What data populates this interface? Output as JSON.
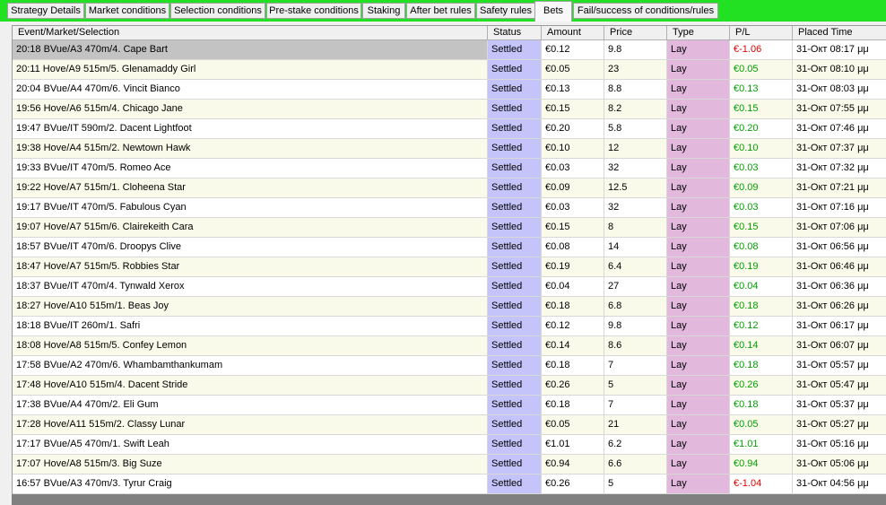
{
  "tabs": [
    {
      "label": "Strategy Details"
    },
    {
      "label": "Market conditions"
    },
    {
      "label": "Selection conditions"
    },
    {
      "label": "Pre-stake conditions"
    },
    {
      "label": "Staking"
    },
    {
      "label": "After bet rules"
    },
    {
      "label": "Safety rules"
    },
    {
      "label": "Bets",
      "active": true
    },
    {
      "label": "Fail/success of conditions/rules"
    }
  ],
  "colors": {
    "tab_strip": "#22e022",
    "status_column": "#c4c4fa",
    "type_column": "#e2b8dc",
    "profit": "#00a000",
    "loss": "#e00000",
    "selected_row": "#c3c3c3"
  },
  "columns": {
    "event": "Event/Market/Selection",
    "status": "Status",
    "amount": "Amount",
    "price": "Price",
    "type": "Type",
    "pl": "P/L",
    "time": "Placed Time"
  },
  "bets": [
    {
      "event": "20:18 BVue/A3 470m/4. Cape Bart",
      "status": "Settled",
      "amount": "€0.12",
      "price": "9.8",
      "type": "Lay",
      "pl": "€-1.06",
      "time": "31-Окт 08:17 μμ"
    },
    {
      "event": "20:11 Hove/A9 515m/5. Glenamaddy Girl",
      "status": "Settled",
      "amount": "€0.05",
      "price": "23",
      "type": "Lay",
      "pl": "€0.05",
      "time": "31-Окт 08:10 μμ"
    },
    {
      "event": "20:04 BVue/A4 470m/6. Vincit Bianco",
      "status": "Settled",
      "amount": "€0.13",
      "price": "8.8",
      "type": "Lay",
      "pl": "€0.13",
      "time": "31-Окт 08:03 μμ"
    },
    {
      "event": "19:56 Hove/A6 515m/4. Chicago Jane",
      "status": "Settled",
      "amount": "€0.15",
      "price": "8.2",
      "type": "Lay",
      "pl": "€0.15",
      "time": "31-Окт 07:55 μμ"
    },
    {
      "event": "19:47 BVue/IT 590m/2. Dacent Lightfoot",
      "status": "Settled",
      "amount": "€0.20",
      "price": "5.8",
      "type": "Lay",
      "pl": "€0.20",
      "time": "31-Окт 07:46 μμ"
    },
    {
      "event": "19:38 Hove/A4 515m/2. Newtown Hawk",
      "status": "Settled",
      "amount": "€0.10",
      "price": "12",
      "type": "Lay",
      "pl": "€0.10",
      "time": "31-Окт 07:37 μμ"
    },
    {
      "event": "19:33 BVue/IT 470m/5. Romeo Ace",
      "status": "Settled",
      "amount": "€0.03",
      "price": "32",
      "type": "Lay",
      "pl": "€0.03",
      "time": "31-Окт 07:32 μμ"
    },
    {
      "event": "19:22 Hove/A7 515m/1. Cloheena Star",
      "status": "Settled",
      "amount": "€0.09",
      "price": "12.5",
      "type": "Lay",
      "pl": "€0.09",
      "time": "31-Окт 07:21 μμ"
    },
    {
      "event": "19:17 BVue/IT 470m/5. Fabulous Cyan",
      "status": "Settled",
      "amount": "€0.03",
      "price": "32",
      "type": "Lay",
      "pl": "€0.03",
      "time": "31-Окт 07:16 μμ"
    },
    {
      "event": "19:07 Hove/A7 515m/6. Clairekeith Cara",
      "status": "Settled",
      "amount": "€0.15",
      "price": "8",
      "type": "Lay",
      "pl": "€0.15",
      "time": "31-Окт 07:06 μμ"
    },
    {
      "event": "18:57 BVue/IT 470m/6. Droopys Clive",
      "status": "Settled",
      "amount": "€0.08",
      "price": "14",
      "type": "Lay",
      "pl": "€0.08",
      "time": "31-Окт 06:56 μμ"
    },
    {
      "event": "18:47 Hove/A7 515m/5. Robbies Star",
      "status": "Settled",
      "amount": "€0.19",
      "price": "6.4",
      "type": "Lay",
      "pl": "€0.19",
      "time": "31-Окт 06:46 μμ"
    },
    {
      "event": "18:37 BVue/IT 470m/4. Tynwald Xerox",
      "status": "Settled",
      "amount": "€0.04",
      "price": "27",
      "type": "Lay",
      "pl": "€0.04",
      "time": "31-Окт 06:36 μμ"
    },
    {
      "event": "18:27 Hove/A10 515m/1. Beas Joy",
      "status": "Settled",
      "amount": "€0.18",
      "price": "6.8",
      "type": "Lay",
      "pl": "€0.18",
      "time": "31-Окт 06:26 μμ"
    },
    {
      "event": "18:18 BVue/IT 260m/1. Safri",
      "status": "Settled",
      "amount": "€0.12",
      "price": "9.8",
      "type": "Lay",
      "pl": "€0.12",
      "time": "31-Окт 06:17 μμ"
    },
    {
      "event": "18:08 Hove/A8 515m/5. Confey Lemon",
      "status": "Settled",
      "amount": "€0.14",
      "price": "8.6",
      "type": "Lay",
      "pl": "€0.14",
      "time": "31-Окт 06:07 μμ"
    },
    {
      "event": "17:58 BVue/A2 470m/6. Whambamthankumam",
      "status": "Settled",
      "amount": "€0.18",
      "price": "7",
      "type": "Lay",
      "pl": "€0.18",
      "time": "31-Окт 05:57 μμ"
    },
    {
      "event": "17:48 Hove/A10 515m/4. Dacent Stride",
      "status": "Settled",
      "amount": "€0.26",
      "price": "5",
      "type": "Lay",
      "pl": "€0.26",
      "time": "31-Окт 05:47 μμ"
    },
    {
      "event": "17:38 BVue/A4 470m/2. Eli Gum",
      "status": "Settled",
      "amount": "€0.18",
      "price": "7",
      "type": "Lay",
      "pl": "€0.18",
      "time": "31-Окт 05:37 μμ"
    },
    {
      "event": "17:28 Hove/A11 515m/2. Classy Lunar",
      "status": "Settled",
      "amount": "€0.05",
      "price": "21",
      "type": "Lay",
      "pl": "€0.05",
      "time": "31-Окт 05:27 μμ"
    },
    {
      "event": "17:17 BVue/A5 470m/1. Swift Leah",
      "status": "Settled",
      "amount": "€1.01",
      "price": "6.2",
      "type": "Lay",
      "pl": "€1.01",
      "time": "31-Окт 05:16 μμ"
    },
    {
      "event": "17:07 Hove/A8 515m/3. Big Suze",
      "status": "Settled",
      "amount": "€0.94",
      "price": "6.6",
      "type": "Lay",
      "pl": "€0.94",
      "time": "31-Окт 05:06 μμ"
    },
    {
      "event": "16:57 BVue/A3 470m/3. Tyrur Craig",
      "status": "Settled",
      "amount": "€0.26",
      "price": "5",
      "type": "Lay",
      "pl": "€-1.04",
      "time": "31-Окт 04:56 μμ"
    }
  ]
}
